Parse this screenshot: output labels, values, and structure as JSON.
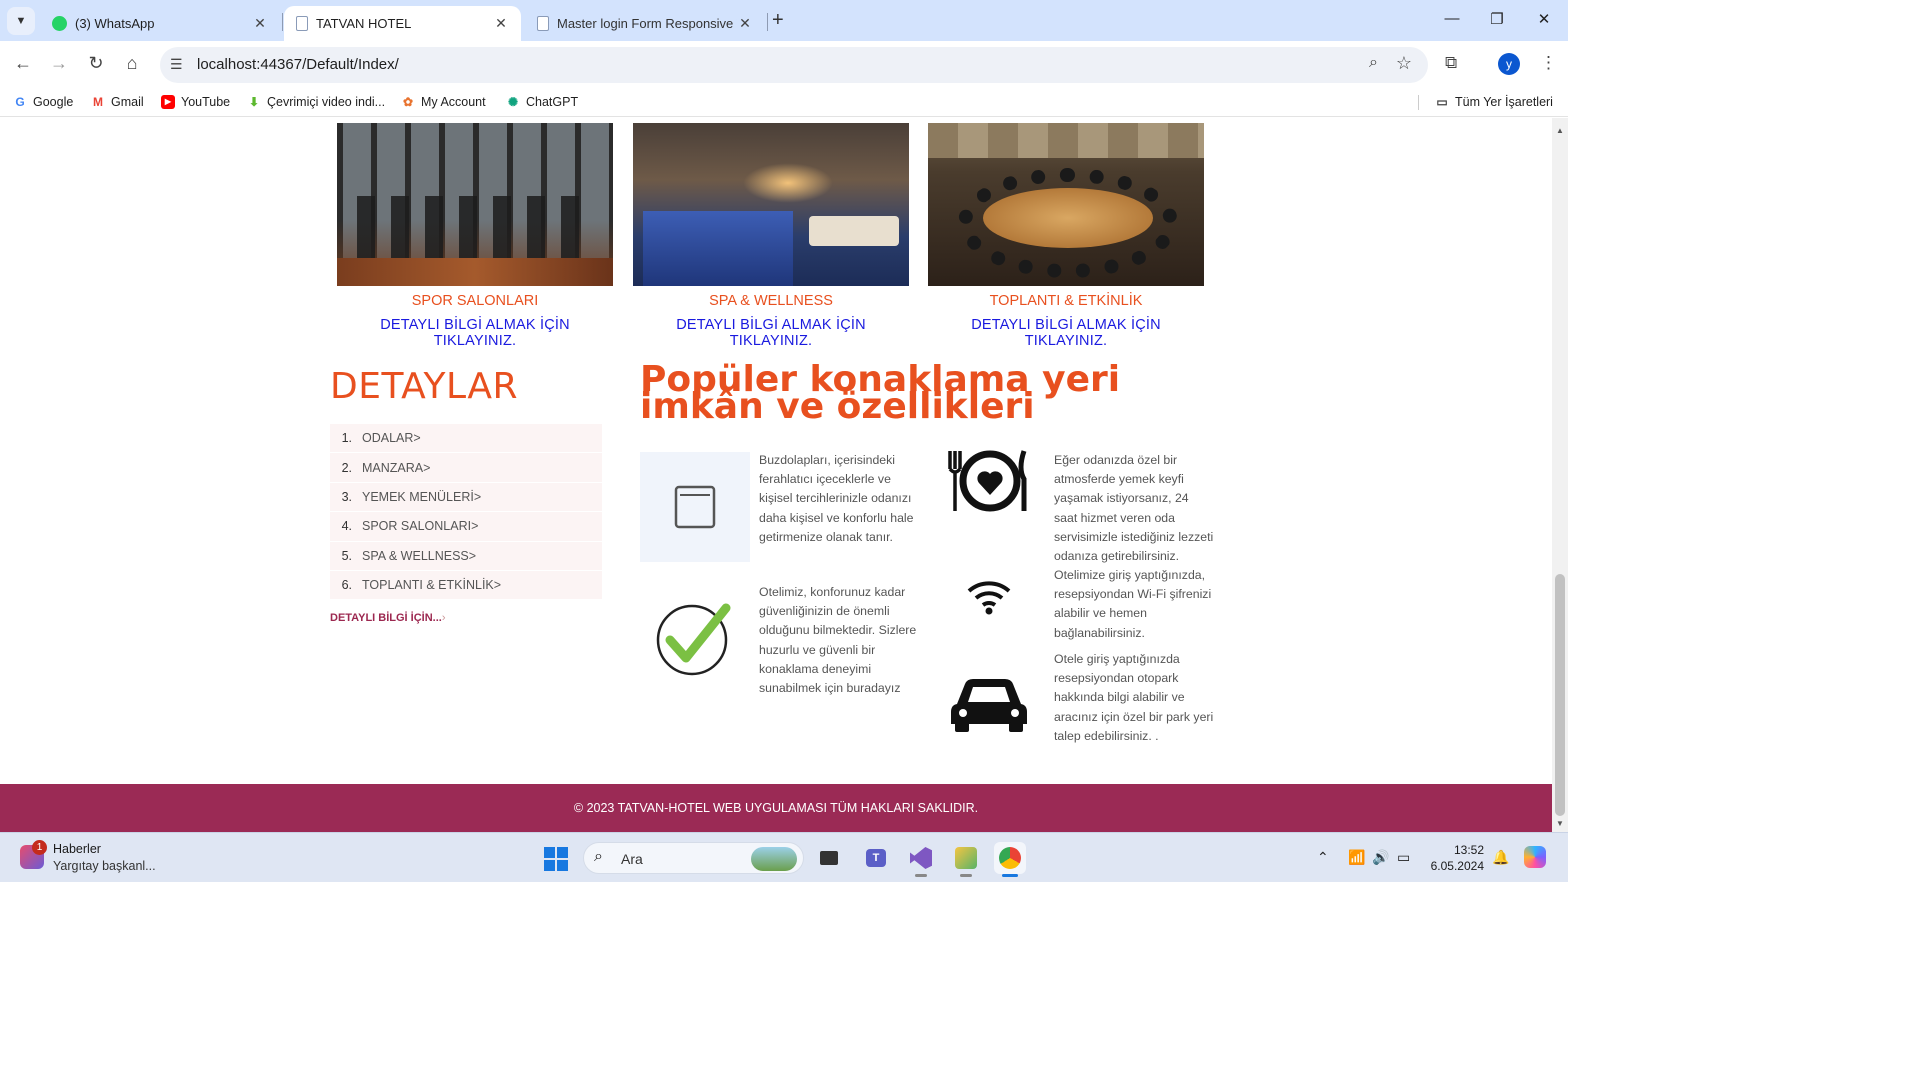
{
  "browser": {
    "tabs": [
      {
        "title": "(3) WhatsApp",
        "icon": "whatsapp-icon"
      },
      {
        "title": "TATVAN HOTEL",
        "icon": "page-icon",
        "active": true
      },
      {
        "title": "Master login Form Responsive W",
        "icon": "page-icon"
      }
    ],
    "url": "localhost:44367/Default/Index/",
    "profile_initial": "y",
    "bookmarks": [
      {
        "label": "Google",
        "icon": "google-icon"
      },
      {
        "label": "Gmail",
        "icon": "gmail-icon"
      },
      {
        "label": "YouTube",
        "icon": "youtube-icon"
      },
      {
        "label": "Çevrimiçi video indi...",
        "icon": "download-icon"
      },
      {
        "label": "My Account",
        "icon": "account-icon"
      },
      {
        "label": "ChatGPT",
        "icon": "chatgpt-icon"
      }
    ],
    "all_bookmarks": "Tüm Yer İşaretleri"
  },
  "services": [
    {
      "title": "SPOR SALONLARI",
      "link": "DETAYLI BİLGİ ALMAK İÇİN TIKLAYINIZ."
    },
    {
      "title": "SPA & WELLNESS",
      "link": "DETAYLI BİLGİ ALMAK İÇİN TIKLAYINIZ."
    },
    {
      "title": "TOPLANTI & ETKİNLİK",
      "link": "DETAYLI BİLGİ ALMAK İÇİN TIKLAYINIZ."
    }
  ],
  "details": {
    "title": "DETAYLAR",
    "items": [
      {
        "num": "1.",
        "label": "ODALAR>"
      },
      {
        "num": "2.",
        "label": "MANZARA>"
      },
      {
        "num": "3.",
        "label": "YEMEK MENÜLERİ>"
      },
      {
        "num": "4.",
        "label": "SPOR SALONLARI>"
      },
      {
        "num": "5.",
        "label": "SPA & WELLNESS>"
      },
      {
        "num": "6.",
        "label": "TOPLANTI & ETKİNLİK>"
      }
    ],
    "more": "DETAYLI BİLGİ İÇİN...",
    "more_arrow": "›"
  },
  "features": {
    "title": "Popüler konaklama yeri imkân ve özellikleri",
    "fridge": "Buzdolapları, içerisindeki ferahlatıcı içeceklerle ve kişisel tercihlerinizle odanızı daha kişisel ve konforlu hale getirmenize olanak tanır.",
    "security": "Otelimiz, konforunuz kadar güvenliğinizin de önemli olduğunu bilmektedir. Sizlere huzurlu ve güvenli bir konaklama deneyimi sunabilmek için buradayız",
    "food": "Eğer odanızda özel bir atmosferde yemek keyfi yaşamak istiyorsanız, 24 saat hizmet veren oda servisimizle istediğiniz lezzeti odanıza getirebilirsiniz.",
    "wifi": "Otelimize giriş yaptığınızda, resepsiyondan Wi-Fi şifrenizi alabilir ve hemen bağlanabilirsiniz.",
    "parking": "Otele giriş yaptığınızda resepsiyondan otopark hakkında bilgi alabilir ve aracınız için özel bir park yeri talep edebilirsiniz. ."
  },
  "footer": "© 2023 TATVAN-HOTEL WEB UYGULAMASI TÜM HAKLARI SAKLIDIR.",
  "taskbar": {
    "news_title": "Haberler",
    "news_sub": "Yargıtay başkanl...",
    "news_badge": "1",
    "search_placeholder": "Ara",
    "time": "13:52",
    "date": "6.05.2024"
  },
  "colors": {
    "accent": "#e8501f",
    "link": "#1a1adf",
    "footer": "#9b2a55"
  }
}
